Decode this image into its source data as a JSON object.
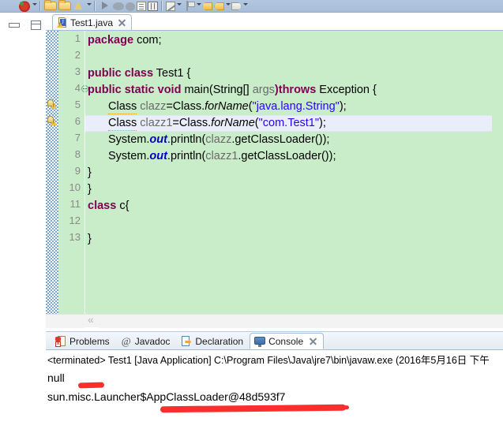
{
  "window": {
    "title": "Eclipse IDE - Test1.java"
  },
  "toolbar": {
    "icons": [
      "debug-icon",
      "dropdown-arrow",
      "separator",
      "open-folder-icon",
      "open-folder-icon-2",
      "export-icon",
      "dropdown-arrow-2",
      "separator-2",
      "run-icon",
      "debug-bug-icon",
      "circle-icon",
      "document-icon",
      "columns-icon",
      "separator-3",
      "edit-icon",
      "dropdown-arrow-3",
      "flag-icon",
      "dropdown-arrow-4",
      "yellow-tag-icon",
      "yellow-tag-icon-2",
      "dropdown-arrow-5",
      "grey-tag-icon",
      "dropdown-arrow-6"
    ]
  },
  "left_bar": {
    "restore_icon": "restore-icon",
    "maximize_icon": "maximize-icon"
  },
  "editor": {
    "tab": {
      "label": "Test1.java",
      "icon": "java-file-warning-icon",
      "close_icon": "close-icon",
      "badge_letter": "J"
    },
    "current_line": 6,
    "warning_lines": [
      5,
      6
    ],
    "folding_lines": [
      4
    ],
    "background_color": "#c9ecc9",
    "highlight_color": "#eaeefa",
    "keyword_color": "#7f0055",
    "string_color": "#2a00ff",
    "lines": [
      {
        "n": 1,
        "text": "package com;"
      },
      {
        "n": 2,
        "text": ""
      },
      {
        "n": 3,
        "text": "public class Test1 {"
      },
      {
        "n": 4,
        "text": "public static void main(String[] args)throws Exception {"
      },
      {
        "n": 5,
        "text": "    Class clazz=Class.forName(\"java.lang.String\");"
      },
      {
        "n": 6,
        "text": "    Class clazz1=Class.forName(\"com.Test1\");"
      },
      {
        "n": 7,
        "text": "    System.out.println(clazz.getClassLoader());"
      },
      {
        "n": 8,
        "text": "    System.out.println(clazz1.getClassLoader());"
      },
      {
        "n": 9,
        "text": "}"
      },
      {
        "n": 10,
        "text": "}"
      },
      {
        "n": 11,
        "text": "class c{"
      },
      {
        "n": 12,
        "text": ""
      },
      {
        "n": 13,
        "text": "}"
      }
    ],
    "tokens": {
      "l1_kw": "package",
      "l1_rest": " com;",
      "l3_kw": "public class",
      "l3_rest": " Test1 {",
      "l4_kw1": "public static void",
      "l4_mid": " main(String[] ",
      "l4_arg": "args",
      "l4_kw2": ")throws",
      "l4_rest": " Exception {",
      "l5_type": "Class",
      "l5_var": " clazz",
      "l5_eq": "=Class.",
      "l5_call": "forName",
      "l5_paren_open": "(",
      "l5_str": "\"java.lang.String\"",
      "l5_tail": ");",
      "l6_type": "Class",
      "l6_var": " clazz1",
      "l6_eq": "=Class.",
      "l6_call": "forName",
      "l6_paren_open": "(",
      "l6_str": "\"com.Test1\"",
      "l6_tail": ");",
      "l7_sys": "System.",
      "l7_out": "out",
      "l7_pr": ".println(",
      "l7_var": "clazz",
      "l7_tail": ".getClassLoader());",
      "l8_sys": "System.",
      "l8_out": "out",
      "l8_pr": ".println(",
      "l8_var": "clazz1",
      "l8_tail": ".getClassLoader());",
      "l9": "}",
      "l10": "}",
      "l11_kw": "class",
      "l11_rest": " c{",
      "l13": "}"
    },
    "scrollbar": {
      "left_arrow": "scroll-left-arrow"
    }
  },
  "bottom_view": {
    "tabs": [
      {
        "label": "Problems",
        "icon": "problems-icon",
        "active": false
      },
      {
        "label": "Javadoc",
        "icon": "javadoc-at-icon",
        "active": false
      },
      {
        "label": "Declaration",
        "icon": "declaration-icon",
        "active": false
      },
      {
        "label": "Console",
        "icon": "console-icon",
        "active": true
      }
    ],
    "close_icon": "close-icon"
  },
  "console": {
    "header": "<terminated> Test1 [Java Application] C:\\Program Files\\Java\\jre7\\bin\\javaw.exe (2016年5月16日 下午",
    "output": [
      "null",
      "sun.misc.Launcher$AppClassLoader@48d593f7"
    ],
    "annotation_color": "#fb2d2d"
  }
}
